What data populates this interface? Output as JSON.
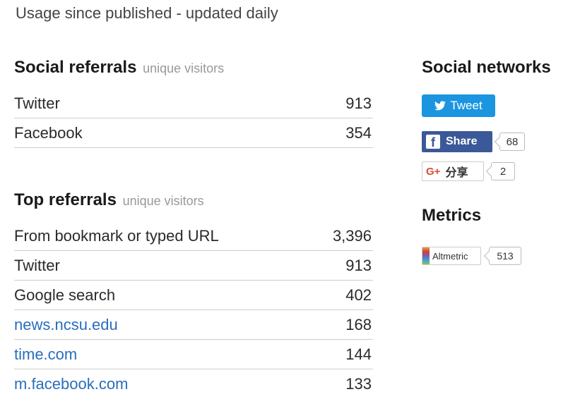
{
  "subtitle": "Usage since published - updated daily",
  "social_referrals": {
    "title": "Social referrals",
    "note": "unique visitors",
    "rows": [
      {
        "label": "Twitter",
        "value": "913"
      },
      {
        "label": "Facebook",
        "value": "354"
      }
    ]
  },
  "top_referrals": {
    "title": "Top referrals",
    "note": "unique visitors",
    "rows": [
      {
        "label": "From bookmark or typed URL",
        "value": "3,396"
      },
      {
        "label": "Twitter",
        "value": "913"
      },
      {
        "label": "Google search",
        "value": "402"
      },
      {
        "label": "news.ncsu.edu",
        "value": "168"
      },
      {
        "label": "time.com",
        "value": "144"
      },
      {
        "label": "m.facebook.com",
        "value": "133"
      }
    ]
  },
  "social_networks": {
    "title": "Social networks",
    "tweet_label": "Tweet",
    "facebook": {
      "label": "Share",
      "count": "68"
    },
    "gplus": {
      "label": "分享",
      "count": "2"
    }
  },
  "metrics": {
    "title": "Metrics",
    "altmetric": {
      "label": "Altmetric",
      "score": "513"
    }
  },
  "colors": {
    "link": "#2a6ebb",
    "twitter": "#1b95e0",
    "facebook": "#3b5998",
    "gplus": "#dd4b39"
  },
  "icons": {
    "tweet": "twitter-bird-icon",
    "share": "facebook-f-icon",
    "gplus": "google-plus-icon",
    "altmetric": "altmetric-donut-icon"
  }
}
